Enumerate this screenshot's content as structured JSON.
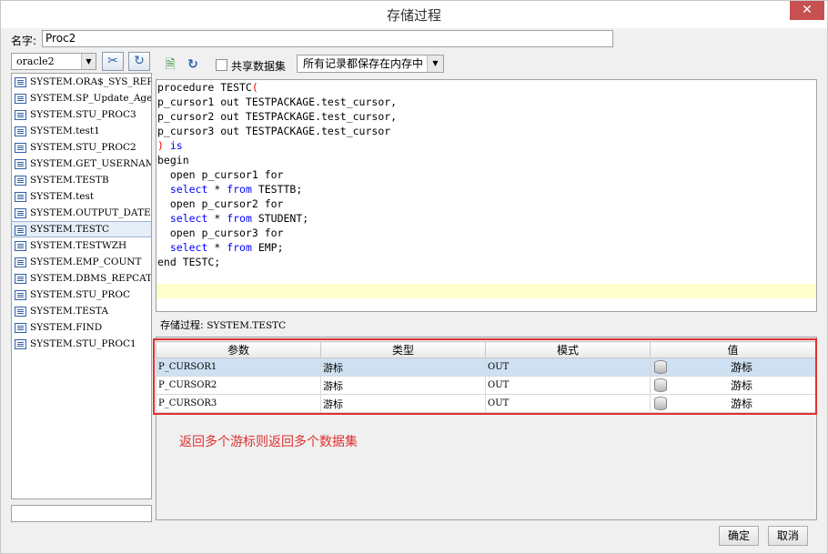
{
  "window": {
    "title": "存储过程",
    "close_glyph": "✕"
  },
  "name": {
    "label": "名字:",
    "value": "Proc2"
  },
  "connection": {
    "selected": "oracle2"
  },
  "procedures": [
    "SYSTEM.ORA$_SYS_REP_AU",
    "SYSTEM.SP_Update_Age",
    "SYSTEM.STU_PROC3",
    "SYSTEM.test1",
    "SYSTEM.STU_PROC2",
    "SYSTEM.GET_USERNAME",
    "SYSTEM.TESTB",
    "SYSTEM.test",
    "SYSTEM.OUTPUT_DATE",
    "SYSTEM.TESTC",
    "SYSTEM.TESTWZH",
    "SYSTEM.EMP_COUNT",
    "SYSTEM.DBMS_REPCAT_AUT",
    "SYSTEM.STU_PROC",
    "SYSTEM.TESTA",
    "SYSTEM.FIND",
    "SYSTEM.STU_PROC1"
  ],
  "selected_procedure_index": 9,
  "toolbar": {
    "share_label": "共享数据集",
    "share_checked": false,
    "storage_mode": "所有记录都保存在内存中"
  },
  "code": [
    [
      {
        "t": "procedure TESTC",
        "c": ""
      },
      {
        "t": "(",
        "c": "paren"
      }
    ],
    [
      {
        "t": "p_cursor1 out TESTPACKAGE.test_cursor,",
        "c": ""
      }
    ],
    [
      {
        "t": "p_cursor2 out TESTPACKAGE.test_cursor,",
        "c": ""
      }
    ],
    [
      {
        "t": "p_cursor3 out TESTPACKAGE.test_cursor",
        "c": ""
      }
    ],
    [
      {
        "t": ")",
        "c": "paren"
      },
      {
        "t": " is",
        "c": "kw"
      }
    ],
    [
      {
        "t": "begin",
        "c": ""
      }
    ],
    [
      {
        "t": "  open p_cursor1 for",
        "c": ""
      }
    ],
    [
      {
        "t": "  ",
        "c": ""
      },
      {
        "t": "select",
        "c": "kw"
      },
      {
        "t": " * ",
        "c": ""
      },
      {
        "t": "from",
        "c": "kw"
      },
      {
        "t": " TESTTB;",
        "c": ""
      }
    ],
    [
      {
        "t": "  open p_cursor2 for",
        "c": ""
      }
    ],
    [
      {
        "t": "  ",
        "c": ""
      },
      {
        "t": "select",
        "c": "kw"
      },
      {
        "t": " * ",
        "c": ""
      },
      {
        "t": "from",
        "c": "kw"
      },
      {
        "t": " STUDENT;",
        "c": ""
      }
    ],
    [
      {
        "t": "  open p_cursor3 for",
        "c": ""
      }
    ],
    [
      {
        "t": "  ",
        "c": ""
      },
      {
        "t": "select",
        "c": "kw"
      },
      {
        "t": " * ",
        "c": ""
      },
      {
        "t": "from",
        "c": "kw"
      },
      {
        "t": " EMP;",
        "c": ""
      }
    ],
    [
      {
        "t": "end TESTC;",
        "c": ""
      }
    ],
    [
      {
        "t": "",
        "c": ""
      }
    ],
    [
      {
        "t": "",
        "c": ""
      }
    ]
  ],
  "current_line_index": 14,
  "status": {
    "label": "存储过程:",
    "value": "SYSTEM.TESTC"
  },
  "params": {
    "headers": [
      "参数",
      "类型",
      "模式",
      "值"
    ],
    "rows": [
      {
        "name": "P_CURSOR1",
        "type": "游标",
        "mode": "OUT",
        "value": "游标"
      },
      {
        "name": "P_CURSOR2",
        "type": "游标",
        "mode": "OUT",
        "value": "游标"
      },
      {
        "name": "P_CURSOR3",
        "type": "游标",
        "mode": "OUT",
        "value": "游标"
      }
    ],
    "selected_row_index": 0
  },
  "annotation": "返回多个游标则返回多个数据集",
  "buttons": {
    "ok": "确定",
    "cancel": "取消"
  },
  "colors": {
    "annotation_red": "#e03030",
    "keyword_blue": "#0000ff",
    "paren_red": "#ff0000",
    "current_line": "#ffffcc"
  }
}
